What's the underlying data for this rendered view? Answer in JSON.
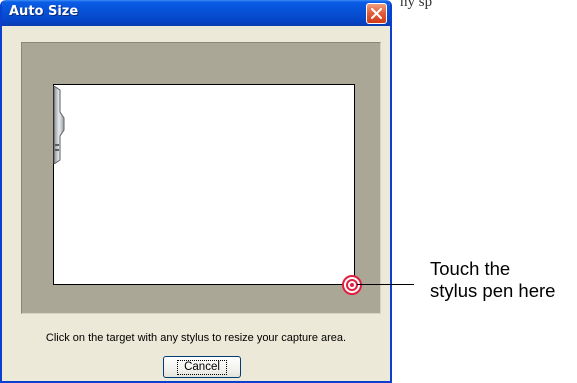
{
  "background": {
    "partial_text": "ny sp"
  },
  "dialog": {
    "title": "Auto Size",
    "close_icon": "close-x-icon",
    "instruction": "Click on the target with any stylus to resize your capture area.",
    "cancel_label": "Cancel",
    "colors": {
      "titlebar": "#0650d6",
      "body": "#ece9d8",
      "panel": "#aba797",
      "close_button": "#e2603c",
      "target": "#e02040"
    }
  },
  "callout": {
    "line1": "Touch the",
    "line2": "stylus pen here"
  }
}
